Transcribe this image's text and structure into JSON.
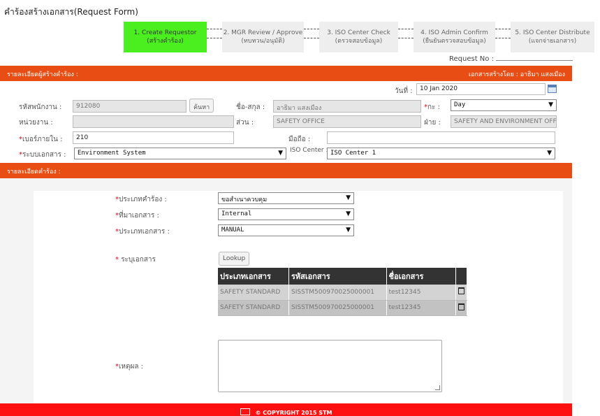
{
  "page": {
    "title": "คำร้องสร้างเอกสาร(Request Form)"
  },
  "steps": [
    {
      "line1": "1. Create Requestor",
      "line2": "(สร้างคำร้อง)",
      "active": true
    },
    {
      "line1": "2. MGR Review / Approve",
      "line2": "(ทบทวน/อนุมัติ)",
      "active": false
    },
    {
      "line1": "3. ISO Center Check",
      "line2": "(ตรวจสอบข้อมูล)",
      "active": false
    },
    {
      "line1": "4. ISO Admin Confirm",
      "line2": "(ยืนยันตรวจสอบข้อมูล)",
      "active": false
    },
    {
      "line1": "5. ISO Center Distribute",
      "line2": "(แจกจ่ายเอกสาร)",
      "active": false
    }
  ],
  "request_no": {
    "label": "Request No :"
  },
  "section1": {
    "title": "รายละเอียดผู้สร้างคำร้อง :",
    "right": "เอกสารสร้างโดย : อาธิมา แสงเมือง"
  },
  "date": {
    "label": "วันที่ :",
    "value": "10 Jan 2020"
  },
  "employee": {
    "id_label": "รหัสพนักงาน :",
    "id_value": "912080",
    "search_label": "ค้นหา",
    "name_label": "ชื่อ-สกุล :",
    "name_value": "อาธิมา แสงเมือง",
    "shift_label": "กะ :",
    "shift_value": "Day",
    "unit_label": "หน่วยงาน :",
    "unit_value": "",
    "section_label": "ส่วน :",
    "section_value": "SAFETY OFFICE",
    "dept_label": "ฝ่าย :",
    "dept_value": "SAFETY AND ENVIRONMENT OFFICE",
    "phone_label": "เบอร์ภายใน :",
    "phone_value": "210",
    "mobile_label": "มือถือ :",
    "mobile_value": "",
    "system_label": "ระบบเอกสาร :",
    "system_value": "Environment System",
    "iso_label": "ISO Center :",
    "iso_value": "ISO Center 1"
  },
  "section2": {
    "title": "รายละเอียดคำร้อง :"
  },
  "request": {
    "type_label": "ประเภทคำร้อง :",
    "type_value": "ขอสำเนาควบคุม",
    "source_label": "ที่มาเอกสาร :",
    "source_value": "Internal",
    "doctype_label": "ประเภทเอกสาร :",
    "doctype_value": "MANUAL",
    "docs_label": "ระบุเอกสาร",
    "lookup_label": "Lookup",
    "reason_label": "เหตุผล :",
    "reason_value": ""
  },
  "doc_table": {
    "headers": [
      "ประเภทเอกสาร",
      "รหัสเอกสาร",
      "ชื่อเอกสาร"
    ],
    "rows": [
      [
        "SAFETY STANDARD",
        "SISSTM500970025000001",
        "test12345"
      ],
      [
        "SAFETY STANDARD",
        "SISSTM500970025000001",
        "test12345"
      ]
    ]
  },
  "footer": {
    "text": "© COPYRIGHT 2015 STM"
  },
  "colors": {
    "section_bar": "#e84d13",
    "active_step": "#4bef1f",
    "footer": "#ff1010",
    "required": "#e0001b"
  }
}
